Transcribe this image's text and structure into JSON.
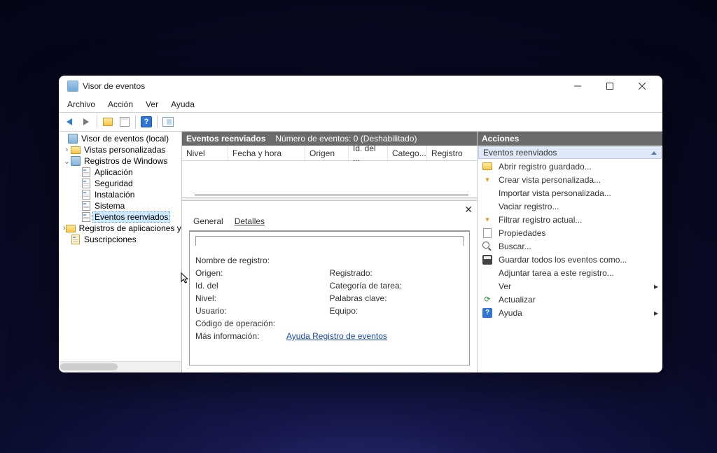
{
  "window": {
    "title": "Visor de eventos"
  },
  "menubar": {
    "file": "Archivo",
    "action": "Acción",
    "view": "Ver",
    "help": "Ayuda"
  },
  "tree": {
    "root": "Visor de eventos (local)",
    "custom_views": "Vistas personalizadas",
    "win_logs": "Registros de Windows",
    "app": "Aplicación",
    "security": "Seguridad",
    "setup": "Instalación",
    "system": "Sistema",
    "forwarded": "Eventos reenviados",
    "app_services": "Registros de aplicaciones y servicios",
    "subscriptions": "Suscripciones"
  },
  "middle": {
    "header_title": "Eventos reenviados",
    "header_count": "Número de eventos: 0 (Deshabilitado)",
    "cols": {
      "level": "Nivel",
      "date": "Fecha y hora",
      "source": "Origen",
      "eventid": "Id. del ...",
      "category": "Catego...",
      "log": "Registro"
    }
  },
  "detail": {
    "tabs": {
      "general": "General",
      "details": "Detalles"
    },
    "log_name": "Nombre de registro:",
    "source": "Origen:",
    "logged": "Registrado:",
    "event_id": "Id. del",
    "category": "Categoría de tarea:",
    "level": "Nivel:",
    "keywords": "Palabras clave:",
    "user": "Usuario:",
    "computer": "Equipo:",
    "opcode": "Código de operación:",
    "more_info": "Más información:",
    "help_link": "Ayuda Registro de eventos"
  },
  "actions": {
    "title": "Acciones",
    "subtitle": "Eventos reenviados",
    "open_saved": "Abrir registro guardado...",
    "create_view": "Crear vista personalizada...",
    "import_view": "Importar vista personalizada...",
    "clear_log": "Vaciar registro...",
    "filter": "Filtrar registro actual...",
    "properties": "Propiedades",
    "find": "Buscar...",
    "save_all": "Guardar todos los eventos como...",
    "attach_task": "Adjuntar tarea a este registro...",
    "view": "Ver",
    "refresh": "Actualizar",
    "help": "Ayuda"
  }
}
